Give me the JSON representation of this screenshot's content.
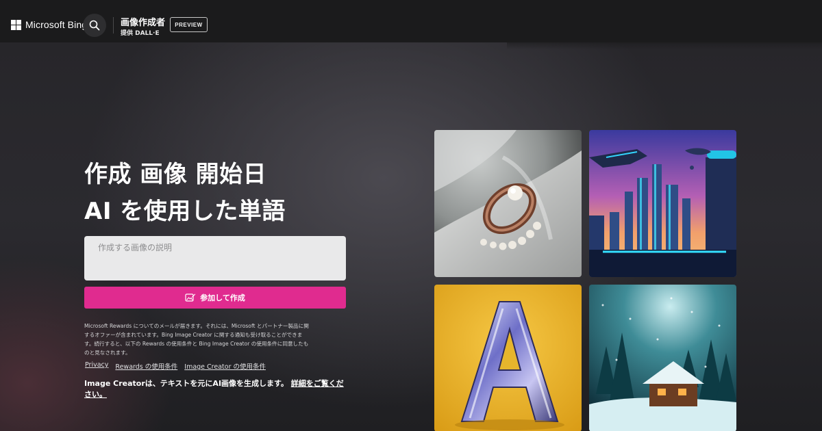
{
  "header": {
    "brand": "Microsoft Bing",
    "product_title": "画像作成者",
    "product_subtitle": "提供 DALL·E",
    "badge": "PREVIEW"
  },
  "hero": {
    "headline_line1": "作成 画像 開始日",
    "headline_line2": "AI を使用した単語",
    "prompt_placeholder": "作成する画像の説明",
    "create_button_label": "参加して作成"
  },
  "disclaimer": "Microsoft Rewards についてのメールが届きます。それには、Microsoft とパートナー製品に関するオファーが含まれています。Bing Image Creator に関する通知も受け取ることができます。続行すると、以下の Rewards の使用条件と Bing Image Creator の使用条件に同意したものと見なされます。",
  "links": [
    "Privacy",
    "Rewards の使用条件",
    "Image Creator の使用条件"
  ],
  "footer": {
    "text": "Image Creatorは、テキストを元にAI画像を生成します。",
    "link": "詳細をご覧ください。"
  },
  "gallery": [
    {
      "subject": "pearl ring on white fabric"
    },
    {
      "subject": "futuristic neon city with flying ships"
    },
    {
      "subject": "chrome letter A on yellow background"
    },
    {
      "subject": "snowy cabin in forest at night"
    }
  ],
  "colors": {
    "accent": "#e02b8f",
    "topbar": "#1b1b1c",
    "background": "#2b2a2f"
  }
}
